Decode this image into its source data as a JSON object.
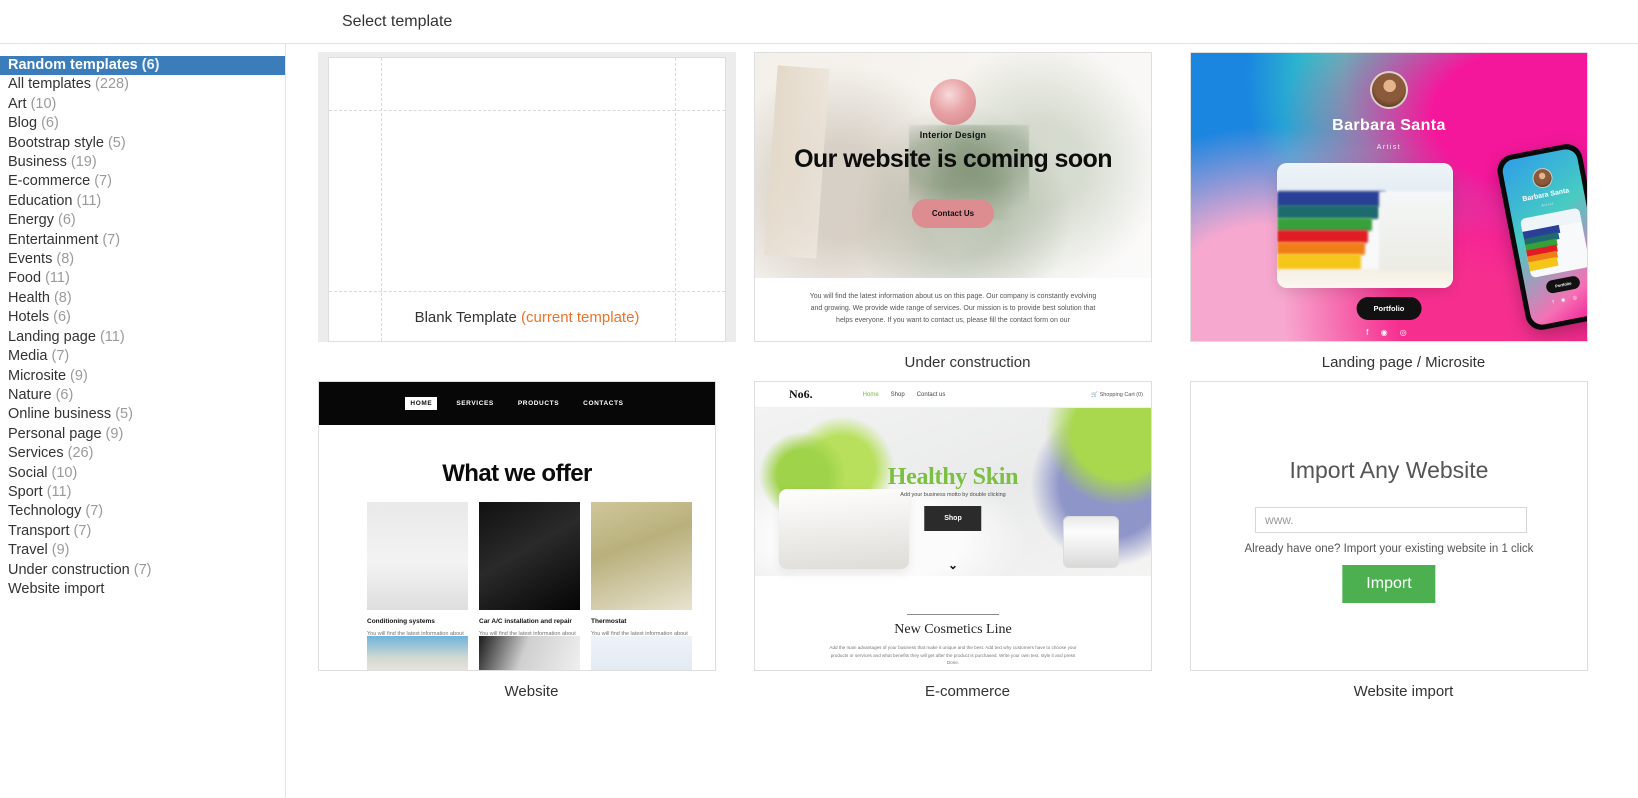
{
  "header": {
    "title": "Select template"
  },
  "sidebar": {
    "items": [
      {
        "label": "Random templates",
        "count": "(6)",
        "selected": true
      },
      {
        "label": "All templates",
        "count": "(228)",
        "selected": false
      },
      {
        "label": "Art",
        "count": "(10)",
        "selected": false
      },
      {
        "label": "Blog",
        "count": "(6)",
        "selected": false
      },
      {
        "label": "Bootstrap style",
        "count": "(5)",
        "selected": false
      },
      {
        "label": "Business",
        "count": "(19)",
        "selected": false
      },
      {
        "label": "E-commerce",
        "count": "(7)",
        "selected": false
      },
      {
        "label": "Education",
        "count": "(11)",
        "selected": false
      },
      {
        "label": "Energy",
        "count": "(6)",
        "selected": false
      },
      {
        "label": "Entertainment",
        "count": "(7)",
        "selected": false
      },
      {
        "label": "Events",
        "count": "(8)",
        "selected": false
      },
      {
        "label": "Food",
        "count": "(11)",
        "selected": false
      },
      {
        "label": "Health",
        "count": "(8)",
        "selected": false
      },
      {
        "label": "Hotels",
        "count": "(6)",
        "selected": false
      },
      {
        "label": "Landing page",
        "count": "(11)",
        "selected": false
      },
      {
        "label": "Media",
        "count": "(7)",
        "selected": false
      },
      {
        "label": "Microsite",
        "count": "(9)",
        "selected": false
      },
      {
        "label": "Nature",
        "count": "(6)",
        "selected": false
      },
      {
        "label": "Online business",
        "count": "(5)",
        "selected": false
      },
      {
        "label": "Personal page",
        "count": "(9)",
        "selected": false
      },
      {
        "label": "Services",
        "count": "(26)",
        "selected": false
      },
      {
        "label": "Social",
        "count": "(10)",
        "selected": false
      },
      {
        "label": "Sport",
        "count": "(11)",
        "selected": false
      },
      {
        "label": "Technology",
        "count": "(7)",
        "selected": false
      },
      {
        "label": "Transport",
        "count": "(7)",
        "selected": false
      },
      {
        "label": "Travel",
        "count": "(9)",
        "selected": false
      },
      {
        "label": "Under construction",
        "count": "(7)",
        "selected": false
      },
      {
        "label": "Website import",
        "count": "",
        "selected": false
      }
    ]
  },
  "templates": {
    "blank": {
      "caption": "Blank Template",
      "current_label": "(current template)"
    },
    "under_construction": {
      "caption": "Under construction",
      "eyebrow": "Interior Design",
      "headline": "Our website is coming soon",
      "button": "Contact Us",
      "body": "You will find the latest information about us on this page. Our company is constantly evolving and growing. We provide wide range of services. Our mission is to provide best solution that helps everyone. If you want to contact us, please fill the contact form on our"
    },
    "landing_microsite": {
      "caption": "Landing page / Microsite",
      "name": "Barbara Santa",
      "role": "Artist",
      "button": "Portfolio",
      "phone_name": "Barbara Santa",
      "phone_role": "Artist",
      "phone_button": "Portfolio",
      "social": "f ⓘ ⓟ"
    },
    "website": {
      "caption": "Website",
      "nav": [
        "HOME",
        "SERVICES",
        "PRODUCTS",
        "CONTACTS"
      ],
      "headline": "What we offer",
      "columns": [
        {
          "title": "Conditioning systems",
          "text": "You will find the latest information about our company here. You will find the latest information about our company here. You will find the latest information about our company"
        },
        {
          "title": "Car A/C installation and repair",
          "text": "You will find the latest information about our company here. You will find the latest information about our company here. You will find the latest information about our company"
        },
        {
          "title": "Thermostat",
          "text": "You will find the latest information about our company here. You will find the latest information about our company here. You will find the latest information about our company"
        }
      ]
    },
    "ecommerce": {
      "caption": "E-commerce",
      "logo": "No6.",
      "nav": [
        "Home",
        "Shop",
        "Contact us"
      ],
      "cart": "Shopping Cart (0)",
      "headline": "Healthy Skin",
      "motto": "Add your business motto by double clicking",
      "button": "Shop",
      "chevron": "⌄",
      "section_title": "New Cosmetics Line",
      "section_text": "Add the main advantages of your business that make it unique and the best. Add text why customers have to choose your products or services and what benefits they will get after the product is purchased. Write your own text, style it and press Done."
    },
    "website_import": {
      "caption": "Website import",
      "heading": "Import Any Website",
      "input_value": "",
      "input_placeholder": "www.",
      "note": "Already have one? Import your existing website in 1 click",
      "button": "Import"
    }
  },
  "colors": {
    "sidebar_selected_bg": "#3b7dbb",
    "current_template_accent": "#e8742c",
    "import_button": "#4caf50"
  }
}
